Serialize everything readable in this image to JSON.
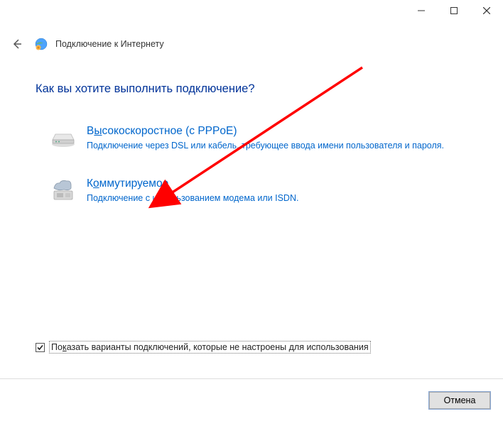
{
  "window": {
    "title": "Подключение к Интернету"
  },
  "content": {
    "question": "Как вы хотите выполнить подключение?",
    "options": {
      "pppoe": {
        "title_pre": "В",
        "title_hot": "ы",
        "title_post": "сокоскоростное (с PPPoE)",
        "desc": "Подключение через DSL или кабель, требующее ввода имени пользователя и пароля."
      },
      "dialup": {
        "title_pre": "К",
        "title_hot": "о",
        "title_post": "ммутируемое",
        "desc": "Подключение с использованием модема или ISDN."
      }
    },
    "checkbox": {
      "checked": true,
      "label_pre": "По",
      "label_hot": "к",
      "label_post": "азать варианты подключений, которые не настроены для использования"
    }
  },
  "footer": {
    "cancel": "Отмена"
  }
}
